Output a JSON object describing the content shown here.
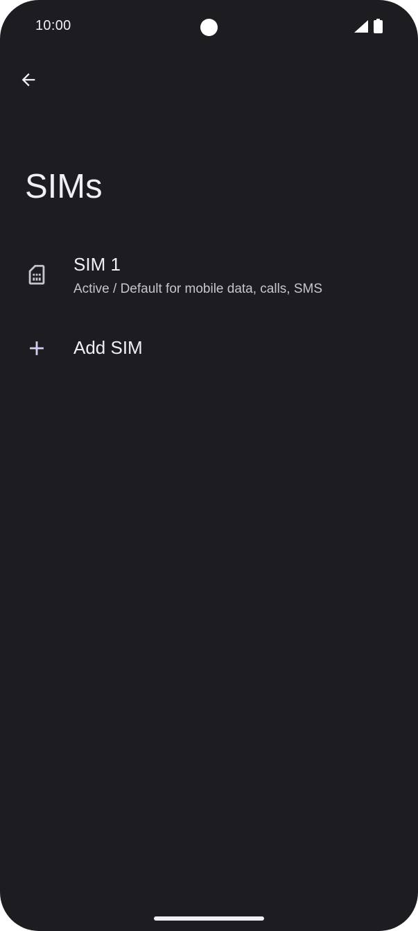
{
  "status_bar": {
    "time": "10:00",
    "icons": [
      "camera-cutout",
      "cell-signal-icon",
      "battery-icon"
    ]
  },
  "app_bar": {
    "back_icon": "arrow-back-icon"
  },
  "page": {
    "title": "SIMs"
  },
  "sims": [
    {
      "icon": "sim-card-icon",
      "title": "SIM 1",
      "summary": "Active / Default for mobile data, calls, SMS"
    }
  ],
  "add_sim": {
    "icon": "plus-icon",
    "label": "Add SIM"
  },
  "colors": {
    "background": "#1d1c21",
    "text_primary": "#f1eff4",
    "text_secondary": "#c8c5cd",
    "icon": "#c8c5cd",
    "status_icons": "#ffffff"
  }
}
